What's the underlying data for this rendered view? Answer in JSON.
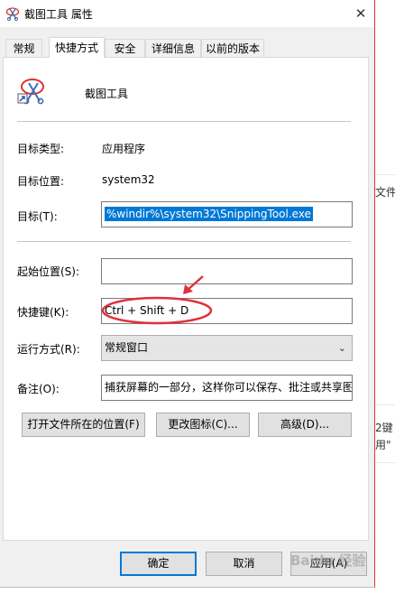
{
  "background_app": {
    "text_1": "文件",
    "text_2": "2键",
    "text_3": "用\""
  },
  "window": {
    "title": "截图工具 属性",
    "close_glyph": "✕"
  },
  "tabs": [
    {
      "label": "常规",
      "active": false
    },
    {
      "label": "快捷方式",
      "active": true
    },
    {
      "label": "安全",
      "active": false
    },
    {
      "label": "详细信息",
      "active": false
    },
    {
      "label": "以前的版本",
      "active": false
    }
  ],
  "header": {
    "name": "截图工具",
    "icon": "snipping-tool-icon"
  },
  "fields": {
    "target_type_label": "目标类型:",
    "target_type_value": "应用程序",
    "target_location_label": "目标位置:",
    "target_location_value": "system32",
    "target_label": "目标(T):",
    "target_value": "%windir%\\system32\\SnippingTool.exe",
    "start_in_label": "起始位置(S):",
    "start_in_value": "",
    "shortcut_key_label": "快捷键(K):",
    "shortcut_key_value": "Ctrl + Shift + D",
    "run_label": "运行方式(R):",
    "run_value": "常规窗口",
    "comment_label": "备注(O):",
    "comment_value": "捕获屏幕的一部分，这样你可以保存、批注或共享图"
  },
  "buttons": {
    "open_location": "打开文件所在的位置(F)",
    "change_icon": "更改图标(C)...",
    "advanced": "高级(D)...",
    "ok": "确定",
    "cancel": "取消",
    "apply": "应用(A)"
  },
  "watermark": "Baidu 经验",
  "colors": {
    "selection": "#0078d7",
    "annotation": "#e0313b"
  }
}
